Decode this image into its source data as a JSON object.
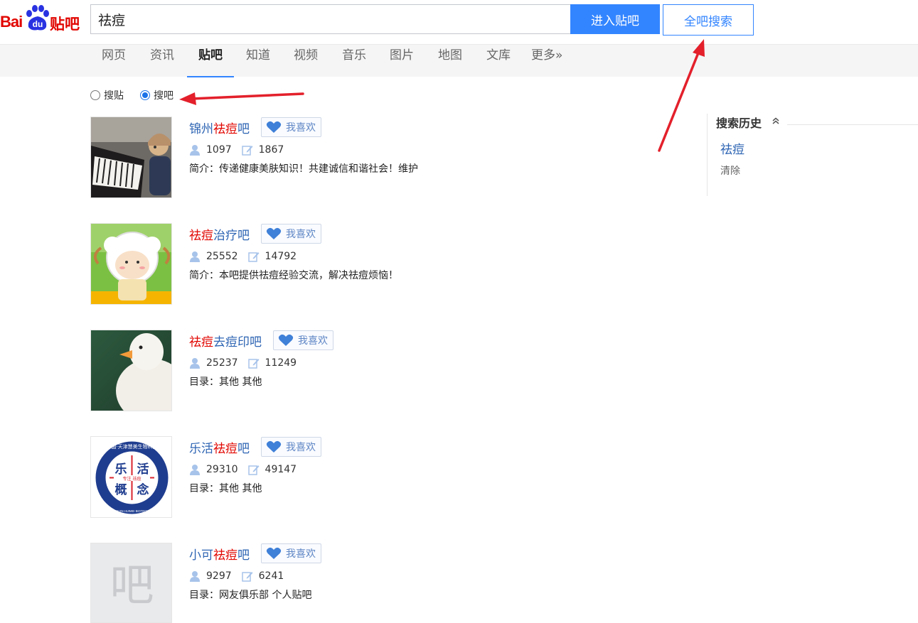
{
  "header": {
    "logo_bai": "Bai",
    "logo_du": "du",
    "logo_tieba": "贴吧",
    "search_value": "祛痘",
    "enter_button": "进入贴吧",
    "all_search_button": "全吧搜索"
  },
  "nav": {
    "items": [
      "网页",
      "资讯",
      "贴吧",
      "知道",
      "视频",
      "音乐",
      "图片",
      "地图",
      "文库",
      "更多»"
    ],
    "active": "贴吧"
  },
  "search_mode": {
    "options": [
      "搜贴",
      "搜吧"
    ],
    "selected": "搜吧"
  },
  "results": [
    {
      "title_pre": "锦州",
      "title_hl": "祛痘",
      "title_post": "吧",
      "like_label": "我喜欢",
      "members": "1097",
      "posts": "1867",
      "desc": "简介：传递健康美肤知识！共建诚信和谐社会！维护",
      "thumb": "piano-child"
    },
    {
      "title_pre": "",
      "title_hl": "祛痘",
      "title_post": "治疗吧",
      "like_label": "我喜欢",
      "members": "25552",
      "posts": "14792",
      "desc": "简介：本吧提供祛痘经验交流，解决祛痘烦恼！",
      "thumb": "cartoon-sheep"
    },
    {
      "title_pre": "",
      "title_hl": "祛痘",
      "title_post": "去痘印吧",
      "like_label": "我喜欢",
      "members": "25237",
      "posts": "11249",
      "desc": "目录：其他   其他",
      "thumb": "duck"
    },
    {
      "title_pre": "乐活",
      "title_hl": "祛痘",
      "title_post": "吧",
      "like_label": "我喜欢",
      "members": "29310",
      "posts": "49147",
      "desc": "目录：其他   其他",
      "thumb": "lehuo-logo",
      "logo_chars": [
        "乐",
        "活",
        "概",
        "念"
      ],
      "logo_ring_text": "中国·天津慧美生物科技",
      "logo_ring_en": "CHINA TIANJIN HUIMEI BIOTECHNOLOGY",
      "logo_center": "专注  祛痘"
    },
    {
      "title_pre": "小可",
      "title_hl": "祛痘",
      "title_post": "吧",
      "like_label": "我喜欢",
      "members": "9297",
      "posts": "6241",
      "desc": "目录：网友俱乐部   个人贴吧",
      "thumb": "default-ba",
      "thumb_char": "吧"
    }
  ],
  "sidebar": {
    "title": "搜索历史",
    "history": [
      "祛痘"
    ],
    "clear": "清除"
  },
  "colors": {
    "brand_blue": "#3385ff",
    "link_blue": "#2d64b3",
    "highlight_red": "#e10601",
    "annotation_red": "#e3202b"
  }
}
